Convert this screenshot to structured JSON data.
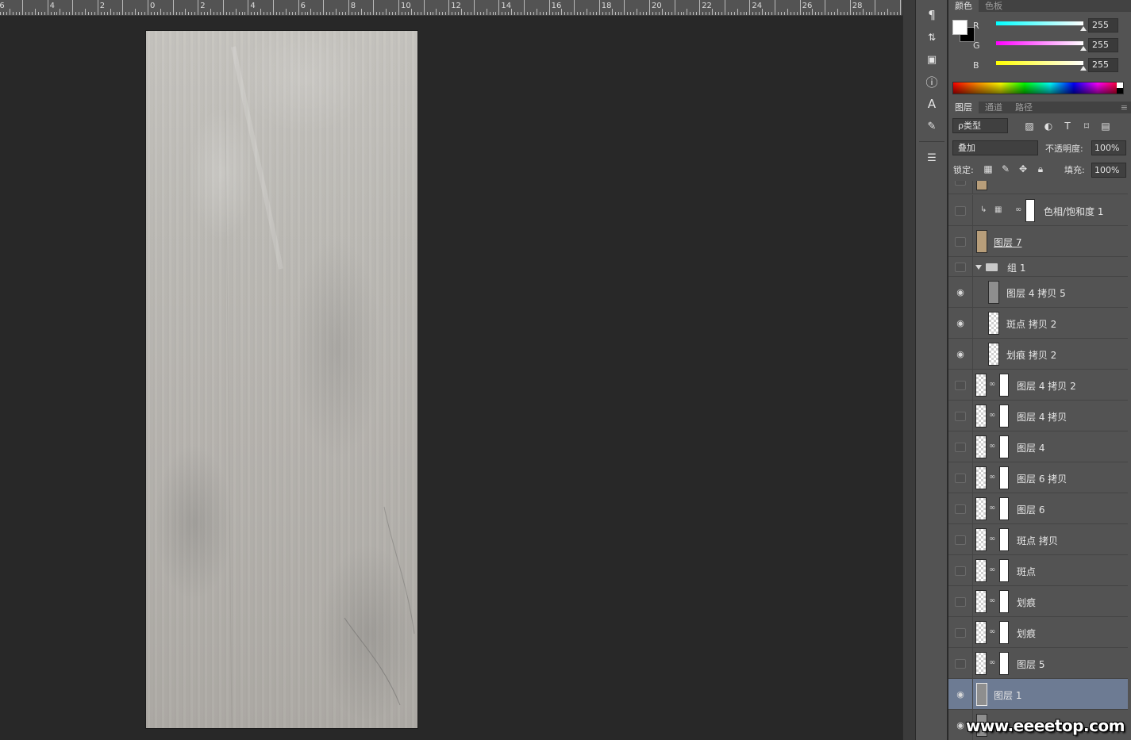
{
  "ruler": {
    "labels": [
      "6",
      "4",
      "2",
      "0",
      "2",
      "4",
      "6",
      "8",
      "10",
      "12",
      "14",
      "16",
      "18",
      "20",
      "22",
      "24",
      "26",
      "28"
    ]
  },
  "color_panel": {
    "tabs": [
      "颜色",
      "色板"
    ],
    "channels": [
      {
        "label": "R",
        "value": "255",
        "gradient": "linear-gradient(90deg,#00ffff,#ffffff)"
      },
      {
        "label": "G",
        "value": "255",
        "gradient": "linear-gradient(90deg,#ff00ff,#ffffff)"
      },
      {
        "label": "B",
        "value": "255",
        "gradient": "linear-gradient(90deg,#ffff00,#ffffff)"
      }
    ]
  },
  "layers_panel": {
    "tabs": [
      "图层",
      "通道",
      "路径"
    ],
    "filter_kind": "ρ类型",
    "blend_mode": "叠加",
    "opacity_label": "不透明度:",
    "opacity_value": "100%",
    "lock_label": "锁定:",
    "fill_label": "填充:",
    "fill_value": "100%",
    "layers": [
      {
        "name": "色相/饱和度 1",
        "visible": false,
        "type": "adjustment"
      },
      {
        "name": "图层 7",
        "visible": false,
        "type": "tan",
        "underline": true
      },
      {
        "name": "组 1",
        "visible": false,
        "type": "group"
      },
      {
        "name": "图层 4 拷贝 5",
        "visible": true,
        "type": "texture",
        "indent": true
      },
      {
        "name": "斑点 拷贝 2",
        "visible": true,
        "type": "checker",
        "indent": true
      },
      {
        "name": "划痕 拷贝 2",
        "visible": true,
        "type": "checker",
        "indent": true
      },
      {
        "name": "图层 4 拷贝 2",
        "visible": false,
        "type": "masked"
      },
      {
        "name": "图层 4 拷贝",
        "visible": false,
        "type": "masked"
      },
      {
        "name": "图层 4",
        "visible": false,
        "type": "masked"
      },
      {
        "name": "图层 6 拷贝",
        "visible": false,
        "type": "masked"
      },
      {
        "name": "图层 6",
        "visible": false,
        "type": "masked"
      },
      {
        "name": "斑点 拷贝",
        "visible": false,
        "type": "masked"
      },
      {
        "name": "斑点",
        "visible": false,
        "type": "masked"
      },
      {
        "name": "划痕",
        "visible": false,
        "type": "masked"
      },
      {
        "name": "划痕",
        "visible": false,
        "type": "masked"
      },
      {
        "name": "图层 5",
        "visible": false,
        "type": "masked"
      },
      {
        "name": "图层 1",
        "visible": true,
        "type": "gray",
        "selected": true
      },
      {
        "name": "",
        "visible": true,
        "type": "gray"
      }
    ]
  },
  "watermark": "www.eeeetop.com"
}
